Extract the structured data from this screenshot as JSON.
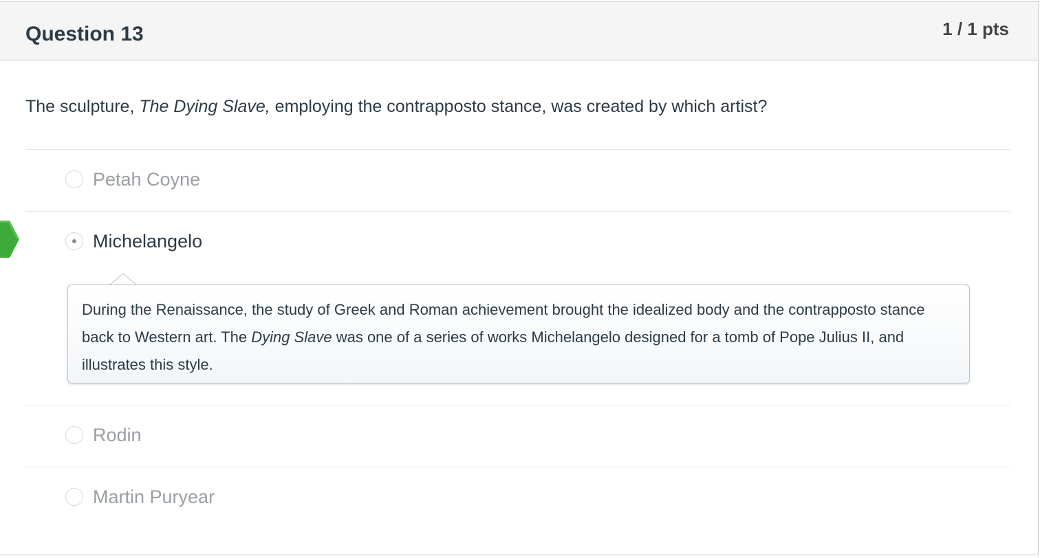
{
  "question": {
    "title": "Question 13",
    "points": "1 / 1 pts",
    "text_before": "The sculpture, ",
    "text_italic": "The Dying Slave,",
    "text_after": " employing the contrapposto stance, was created by which artist?"
  },
  "answers": [
    {
      "label": "Petah Coyne",
      "selected": false
    },
    {
      "label": "Michelangelo",
      "selected": true,
      "correct": true
    },
    {
      "label": "Rodin",
      "selected": false
    },
    {
      "label": "Martin Puryear",
      "selected": false
    }
  ],
  "comment": {
    "part1": "During the Renaissance, the study of Greek and Roman achievement brought the idealized body and the contrapposto stance back to Western art. The ",
    "italic": "Dying Slave",
    "part2": " was one of a series of works Michelangelo designed for a tomb of Pope Julius II, and illustrates this style."
  },
  "colors": {
    "correct_marker": "#3daa3a",
    "header_bg": "#f5f5f5",
    "text": "#2d3b45",
    "muted_text": "#9a9fa3"
  },
  "icons": {
    "correct_marker": "correct-answer-arrow-icon",
    "radio": "radio-button-icon",
    "comment_pointer": "comment-pointer-icon"
  }
}
